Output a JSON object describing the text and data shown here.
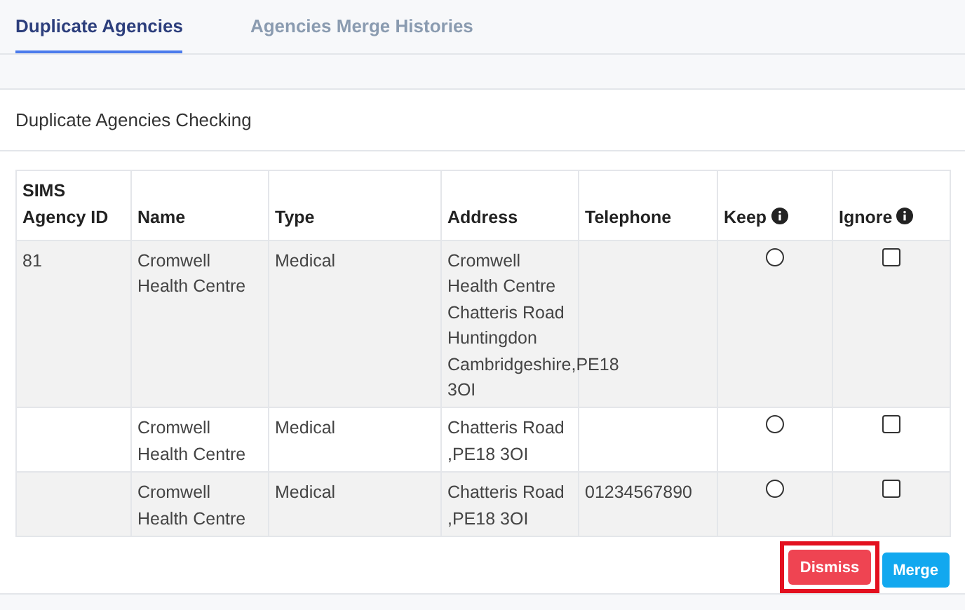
{
  "tabs": [
    {
      "label": "Duplicate Agencies",
      "selected": true
    },
    {
      "label": "Agencies Merge Histories",
      "selected": false
    }
  ],
  "card": {
    "title": "Duplicate Agencies Checking"
  },
  "table": {
    "columns": [
      {
        "label": "SIMS Agency ID"
      },
      {
        "label": "Name"
      },
      {
        "label": "Type"
      },
      {
        "label": "Address"
      },
      {
        "label": "Telephone"
      },
      {
        "label": "Keep",
        "info": true
      },
      {
        "label": "Ignore",
        "info": true
      }
    ],
    "rows": [
      {
        "id": "81",
        "name": "Cromwell Health Centre",
        "type": "Medical",
        "address_lines": [
          "Cromwell",
          "Health Centre",
          "Chatteris Road",
          "Huntingdon",
          "Cambridgeshire,PE18",
          "3OI"
        ],
        "telephone": "",
        "keep": false,
        "ignore": false
      },
      {
        "id": "",
        "name": "Cromwell Health Centre",
        "type": "Medical",
        "address_lines": [
          "Chatteris Road",
          ",PE18 3OI"
        ],
        "telephone": "",
        "keep": false,
        "ignore": false
      },
      {
        "id": "",
        "name": "Cromwell Health Centre",
        "type": "Medical",
        "address_lines": [
          "Chatteris Road",
          ",PE18 3OI"
        ],
        "telephone": "01234567890",
        "keep": false,
        "ignore": false
      }
    ]
  },
  "buttons": [
    {
      "label": "Dismiss",
      "kind": "danger",
      "highlighted": true
    },
    {
      "label": "Merge",
      "kind": "primary",
      "highlighted": false
    }
  ]
}
